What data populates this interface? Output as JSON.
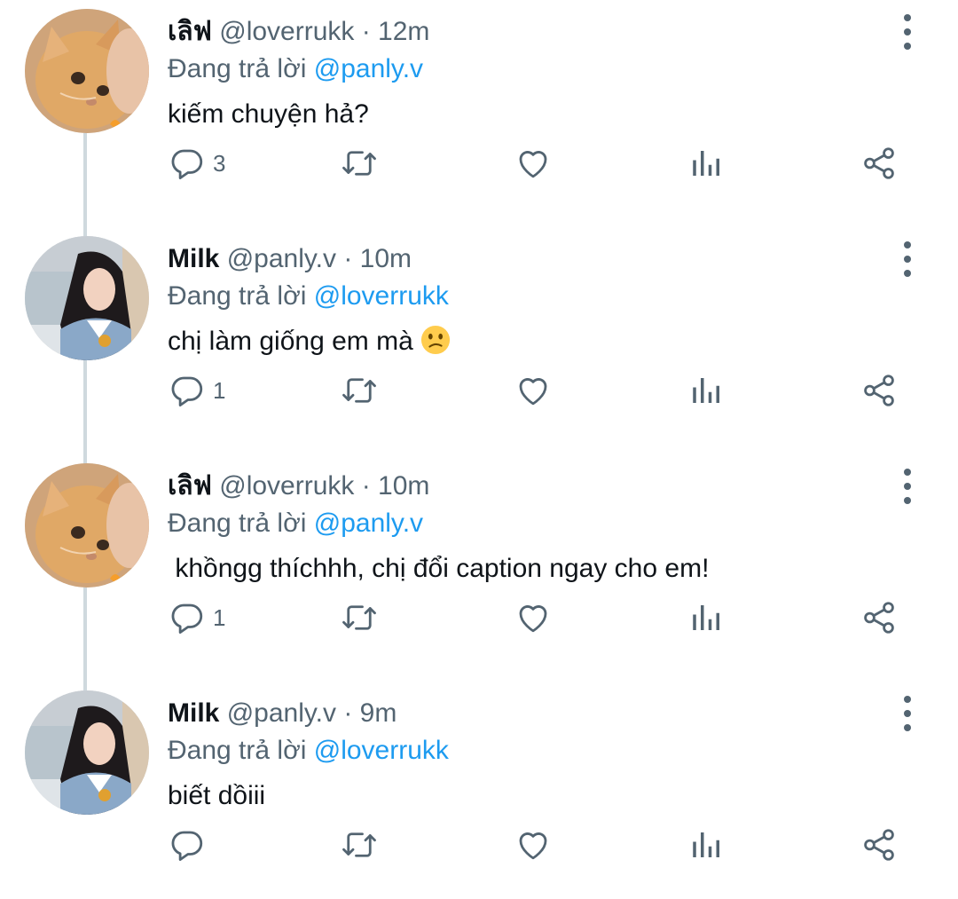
{
  "reply_prefix": "Đang trả lời",
  "tweets": [
    {
      "display_name": "เลิฟ",
      "handle": "@loverrukk",
      "time": "· 12m",
      "reply_to": "@panly.v",
      "text": "kiếm chuyện hả?",
      "emoji": "",
      "reply_count": "3",
      "avatar": "cat"
    },
    {
      "display_name": "Milk",
      "handle": "@panly.v",
      "time": "· 10m",
      "reply_to": "@loverrukk",
      "text": "chị làm giống em mà ",
      "emoji": "confused-face",
      "reply_count": "1",
      "avatar": "girl"
    },
    {
      "display_name": "เลิฟ",
      "handle": "@loverrukk",
      "time": "· 10m",
      "reply_to": "@panly.v",
      "text": " khồngg thíchhh, chị đổi caption ngay cho em!",
      "emoji": "",
      "reply_count": "1",
      "avatar": "cat"
    },
    {
      "display_name": "Milk",
      "handle": "@panly.v",
      "time": "· 9m",
      "reply_to": "@loverrukk",
      "text": "biết dồiii",
      "emoji": "",
      "reply_count": "",
      "avatar": "girl"
    }
  ],
  "icons": {
    "reply": "reply-icon",
    "retweet": "retweet-icon",
    "like": "heart-icon",
    "views": "views-icon",
    "share": "share-icon",
    "more": "more-vertical-icon"
  },
  "colors": {
    "text": "#0f1419",
    "secondary": "#536471",
    "mention": "#1d9bf0",
    "thread_line": "#cfd9de"
  }
}
